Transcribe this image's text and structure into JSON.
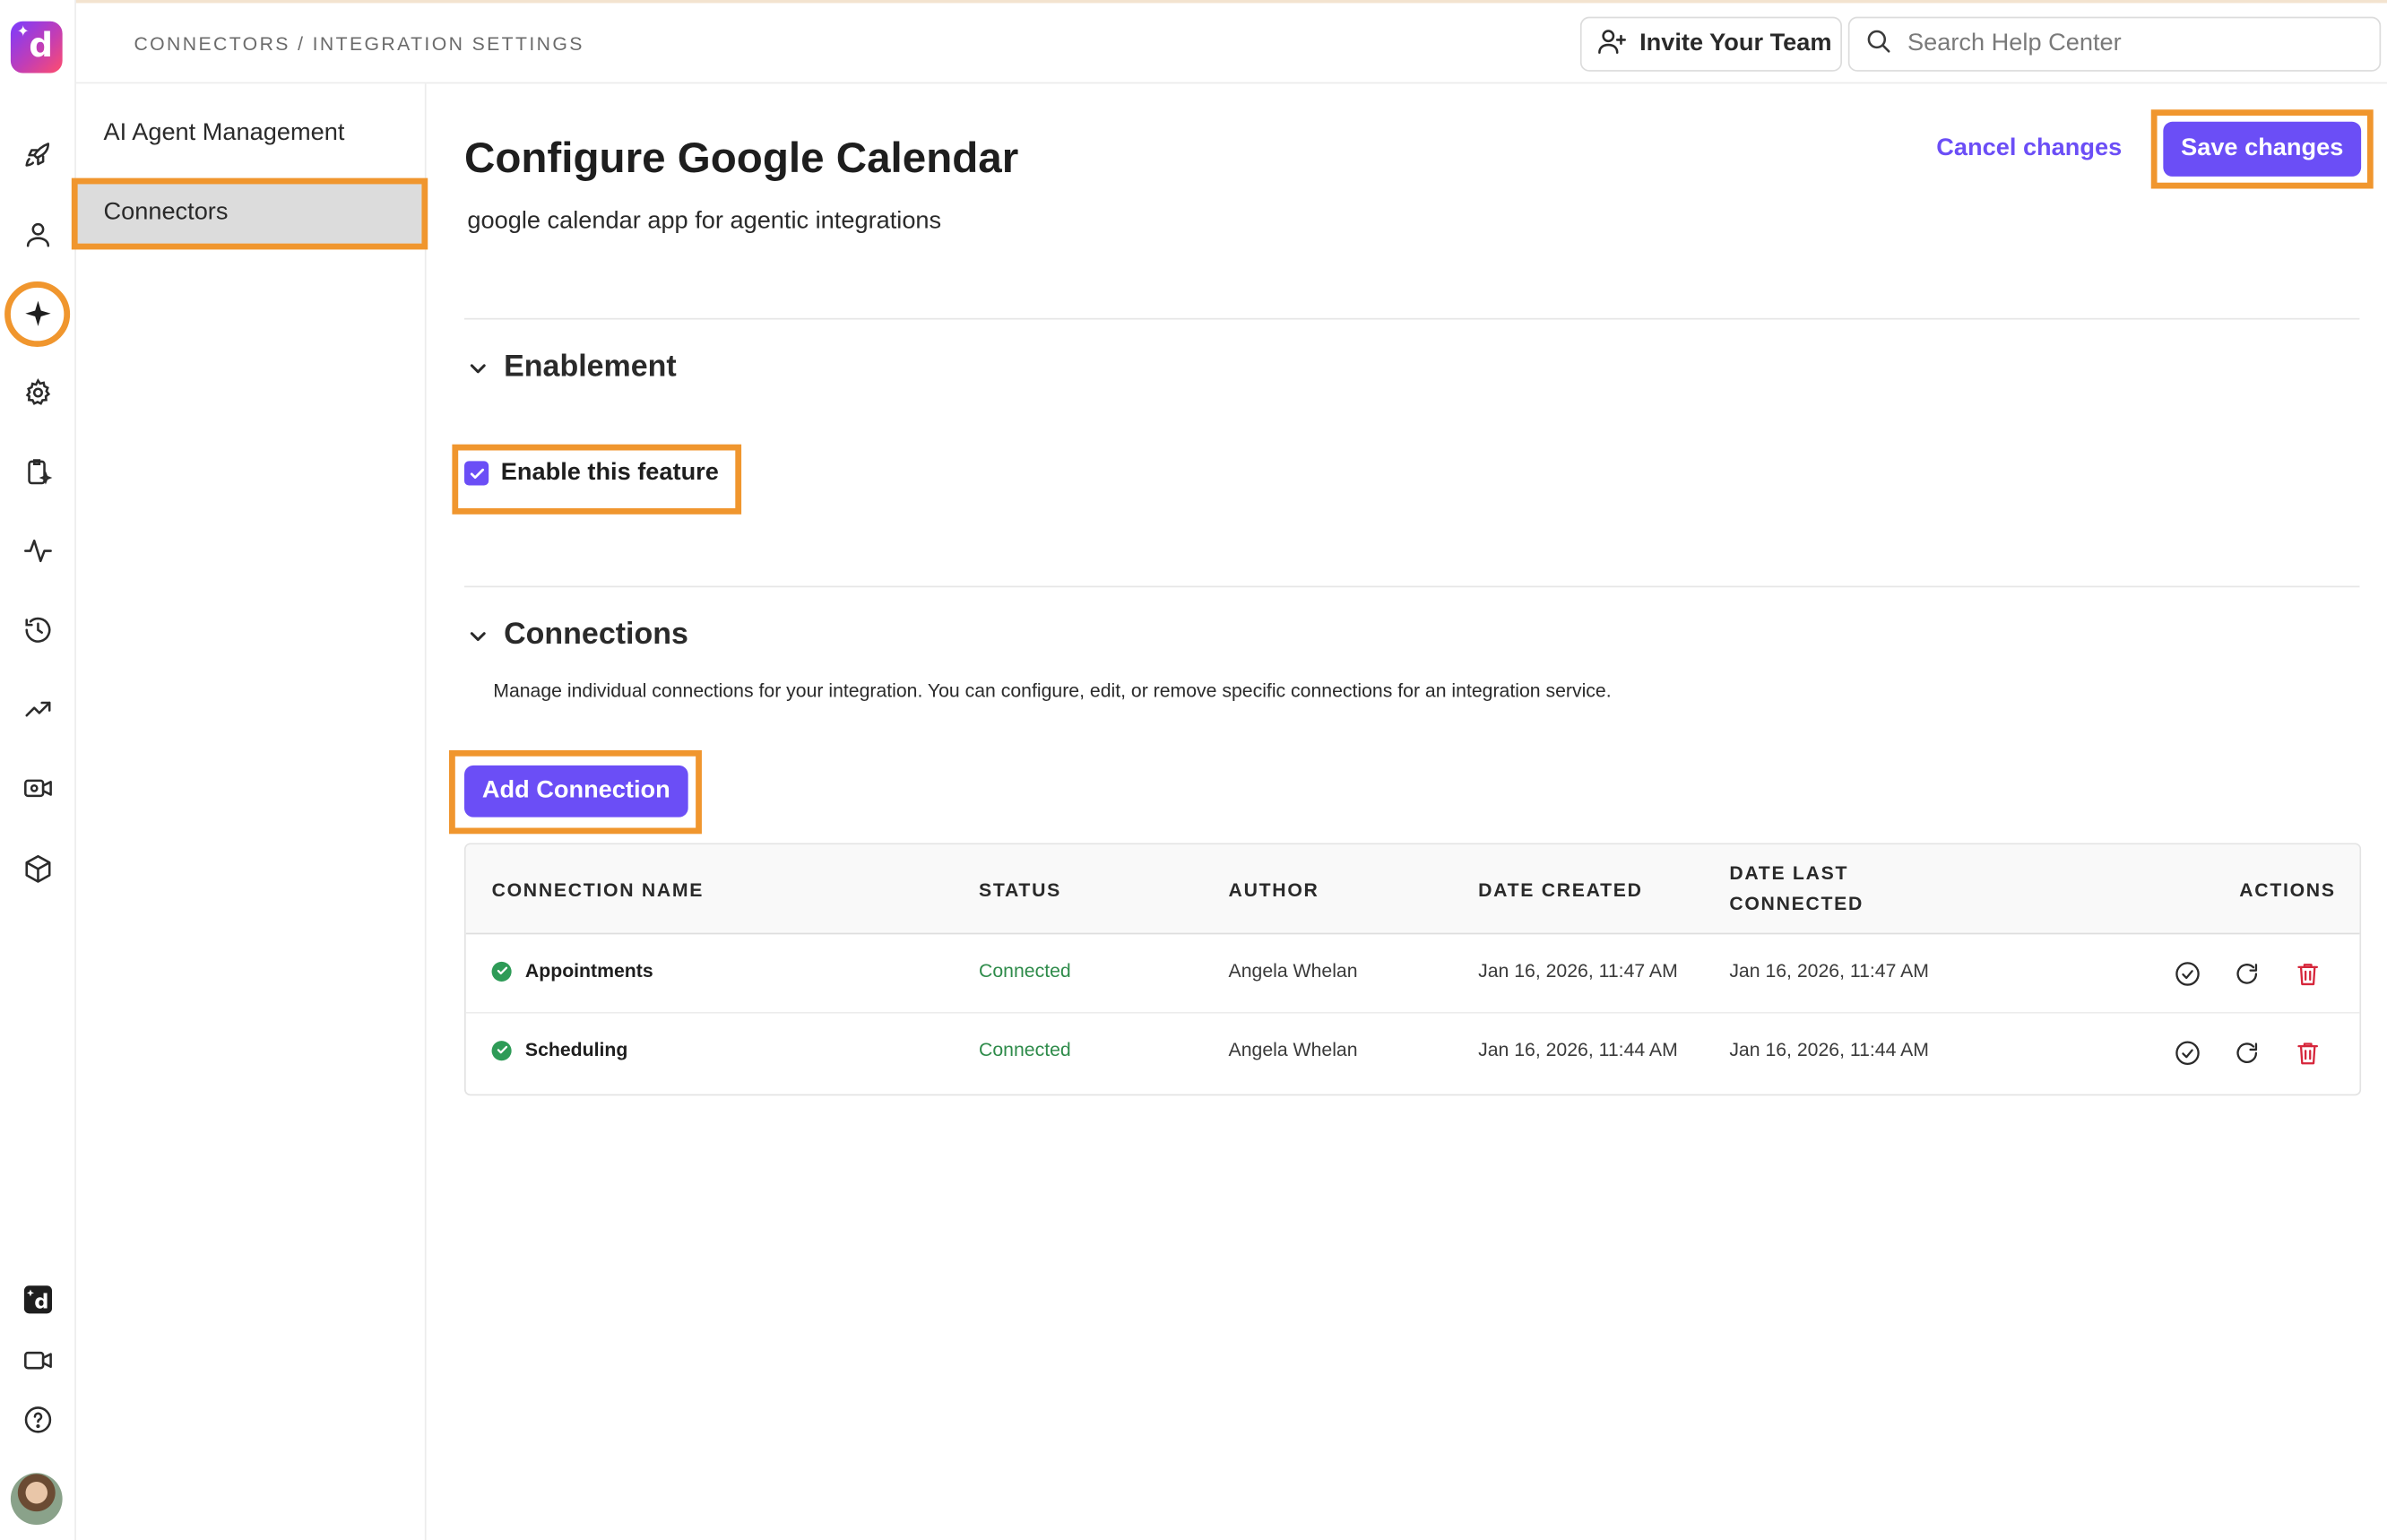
{
  "topbar": {
    "breadcrumb": "CONNECTORS / INTEGRATION SETTINGS",
    "invite_label": "Invite Your Team",
    "search_placeholder": "Search Help Center",
    "search_value": ""
  },
  "rail": {
    "items": [
      "rocket-icon",
      "user-icon",
      "sparkle-icon",
      "gear-icon",
      "clipboard-sparkle-icon",
      "activity-icon",
      "history-icon",
      "trend-up-icon",
      "video-settings-icon",
      "cube-icon"
    ],
    "bottom_items": [
      "app-logo-icon",
      "video-icon",
      "help-icon",
      "avatar"
    ],
    "active_item": "sparkle-icon"
  },
  "subnav": {
    "items": [
      {
        "label": "AI Agent Management",
        "active": false
      },
      {
        "label": "Connectors",
        "active": true
      }
    ]
  },
  "main": {
    "title": "Configure Google Calendar",
    "description": "google calendar app for agentic integrations",
    "cancel_label": "Cancel changes",
    "save_label": "Save changes"
  },
  "enablement": {
    "title": "Enablement",
    "checkbox_label": "Enable this feature",
    "checked": true
  },
  "connections": {
    "title": "Connections",
    "description": "Manage individual connections for your integration. You can configure, edit, or remove specific connections for an integration service.",
    "add_label": "Add Connection",
    "columns": [
      "CONNECTION NAME",
      "STATUS",
      "AUTHOR",
      "DATE CREATED",
      "DATE LAST CONNECTED",
      "ACTIONS"
    ],
    "rows": [
      {
        "name": "Appointments",
        "status": "Connected",
        "author": "Angela Whelan",
        "created": "Jan 16, 2026, 11:47 AM",
        "last_connected": "Jan 16, 2026, 11:47 AM"
      },
      {
        "name": "Scheduling",
        "status": "Connected",
        "author": "Angela Whelan",
        "created": "Jan 16, 2026, 11:44 AM",
        "last_connected": "Jan 16, 2026, 11:44 AM"
      }
    ]
  },
  "colors": {
    "accent": "#6b4ef6",
    "highlight": "#f0962e",
    "status_connected": "#2e8b4a",
    "danger": "#d6263b"
  }
}
